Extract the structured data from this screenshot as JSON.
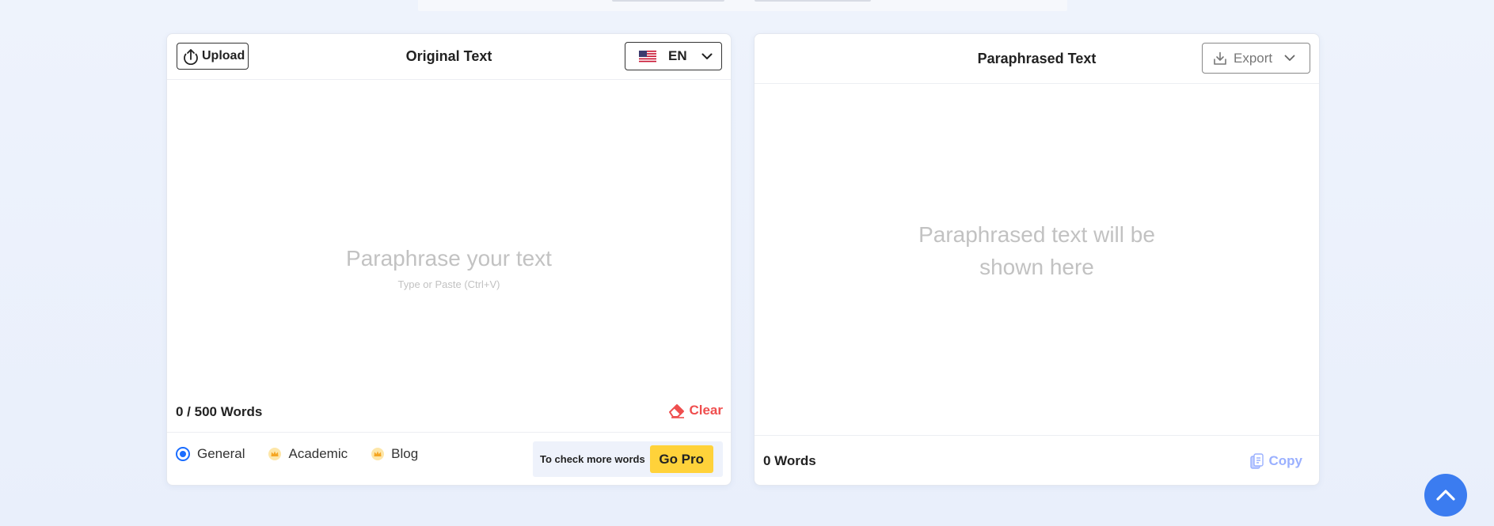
{
  "left_panel": {
    "upload_label": "Upload",
    "title": "Original Text",
    "language": "EN",
    "placeholder_main": "Paraphrase your text",
    "placeholder_sub": "Type or Paste (Ctrl+V)",
    "word_count": "0 / 500 Words",
    "clear_label": "Clear",
    "modes": [
      {
        "label": "General",
        "selected": true,
        "icon": "radio-selected"
      },
      {
        "label": "Academic",
        "selected": false,
        "icon": "crown-icon"
      },
      {
        "label": "Blog",
        "selected": false,
        "icon": "crown-icon"
      }
    ],
    "pro_prompt": "To check more words",
    "gopro_label": "Go Pro"
  },
  "right_panel": {
    "title": "Paraphrased Text",
    "export_label": "Export",
    "placeholder": "Paraphrased text will be shown here",
    "word_count": "0 Words",
    "copy_label": "Copy"
  },
  "colors": {
    "accent_blue": "#1a6dff",
    "clear_red": "#ef4e4e",
    "gopro_yellow": "#ffd23a",
    "copy_light_blue": "#9ab0ff",
    "scroll_button": "#3b7cf0"
  }
}
